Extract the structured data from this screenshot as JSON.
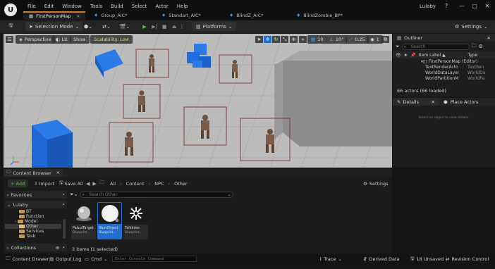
{
  "menu": [
    "File",
    "Edit",
    "Window",
    "Tools",
    "Build",
    "Select",
    "Actor",
    "Help"
  ],
  "user": "Lulaby",
  "window_controls": {
    "help": "?",
    "minimize": "—",
    "maximize": "▢",
    "close": "✕"
  },
  "doc_tabs": [
    {
      "label": "FirstPersonMap",
      "active": true
    },
    {
      "label": "Group_AIC*",
      "active": false
    },
    {
      "label": "Standart_AIC*",
      "active": false
    },
    {
      "label": "BlindZ_AIC*",
      "active": false
    },
    {
      "label": "BlindZombie_BP*",
      "active": false
    }
  ],
  "toolbar": {
    "selection_mode": "Selection Mode",
    "platforms": "Platforms",
    "settings": "Settings"
  },
  "viewport": {
    "perspective": "Perspective",
    "lit": "Lit",
    "show": "Show",
    "scalability": "Scalability: Low",
    "grid_snap": "10",
    "rot_snap": "10°",
    "scale_snap": "0.25",
    "camera_speed": "1"
  },
  "outliner": {
    "title": "Outliner",
    "search_placeholder": "Search",
    "col_label": "Item Label ▲",
    "col_type": "Type",
    "items": [
      {
        "label": "FirstPersonMap (Editor)",
        "type": ""
      },
      {
        "label": "TextRenderActo",
        "type": "TextRen"
      },
      {
        "label": "WorldDataLayer",
        "type": "WorldDa"
      },
      {
        "label": "WorldPartitionM",
        "type": "WorldPa"
      }
    ],
    "status": "66 actors (66 loaded)"
  },
  "details": {
    "tab": "Details",
    "place_actors": "Place Actors",
    "hint": "Select an object to view details."
  },
  "content_browser": {
    "tab": "Content Browser",
    "add": "+ Add",
    "import": "Import",
    "save_all": "Save All",
    "path": [
      "All",
      "Content",
      "NPC",
      "Other"
    ],
    "settings": "Settings",
    "favorites": "Favorites",
    "root": "Lulaby",
    "search_placeholder": "Search Other",
    "folders": [
      "BT",
      "Function",
      "Model",
      "Other",
      "Services",
      "Task"
    ],
    "selected_folder": "Other",
    "collections": "Collections",
    "assets": [
      {
        "name": "PatrolTarget",
        "type": "Blueprint...",
        "selected": false
      },
      {
        "name": "StunObject",
        "type": "Blueprint...",
        "selected": true
      },
      {
        "name": "TalkInter",
        "type": "Blueprint...",
        "selected": false
      }
    ],
    "status": "3 items (1 selected)"
  },
  "statusbar": {
    "content_drawer": "Content Drawer",
    "output_log": "Output Log",
    "cmd": "Cmd",
    "console_placeholder": "Enter Console Command",
    "trace": "Trace",
    "derived_data": "Derived Data",
    "unsaved": "18 Unsaved",
    "revision_control": "Revision Control"
  },
  "colors": {
    "accent_orange": "#d07a22",
    "selection_blue": "#1f6fd1",
    "cube_blue": "#1f6de0",
    "play_green": "#5cbf4a"
  }
}
